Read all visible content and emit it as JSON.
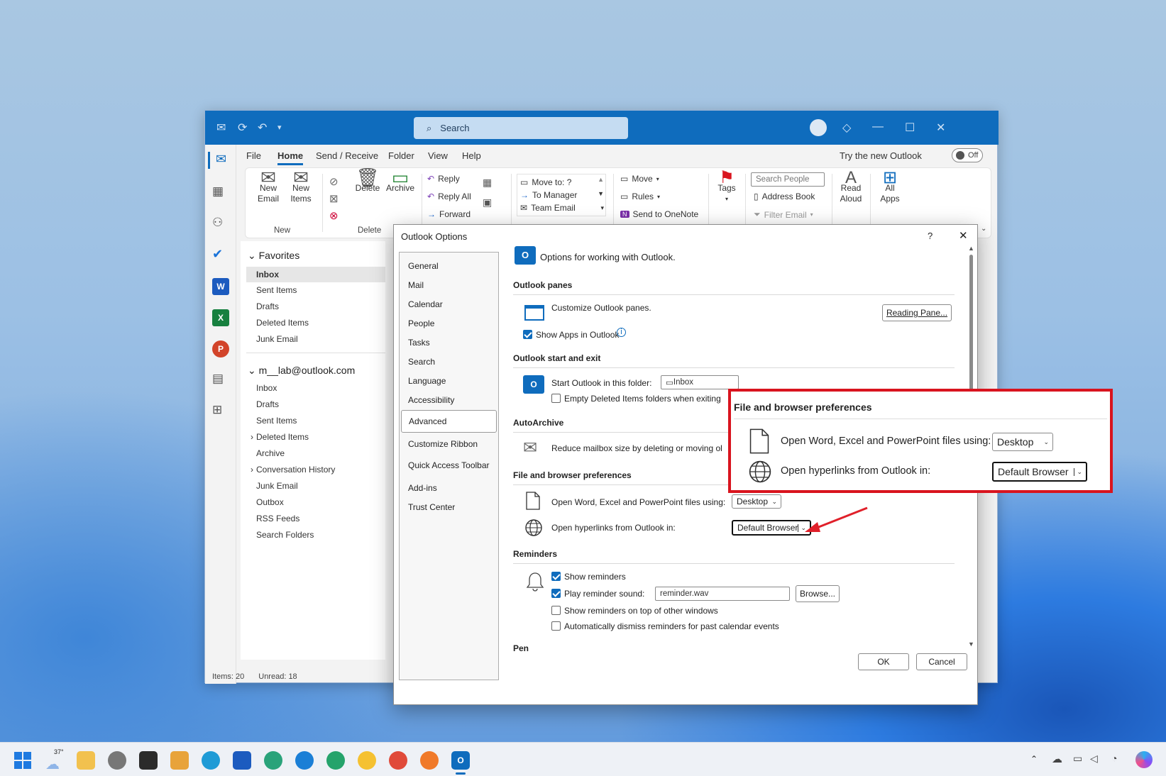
{
  "window": {
    "search_placeholder": "Search",
    "menu": [
      "File",
      "Home",
      "Send / Receive",
      "Folder",
      "View",
      "Help"
    ],
    "try_new": "Try the new Outlook",
    "toggle_label": "Off"
  },
  "ribbon": {
    "new_email": "New Email",
    "new_items": "New Items",
    "group_new": "New",
    "delete": "Delete",
    "archive": "Archive",
    "group_delete": "Delete",
    "reply": "Reply",
    "reply_all": "Reply All",
    "forward": "Forward",
    "quick_steps": [
      "Move to: ?",
      "To Manager",
      "Team Email"
    ],
    "move": "Move",
    "rules": "Rules",
    "send_onenote": "Send to OneNote",
    "tags": "Tags",
    "search_people": "Search People",
    "address_book": "Address Book",
    "filter_email": "Filter Email",
    "read_aloud": "Read Aloud",
    "all_apps": "All Apps"
  },
  "folders": {
    "favorites_header": "Favorites",
    "favorites": [
      "Inbox",
      "Sent Items",
      "Drafts",
      "Deleted Items",
      "Junk Email"
    ],
    "account_header": "m__lab@outlook.com",
    "account_items": [
      "Inbox",
      "Drafts",
      "Sent Items",
      "Deleted Items",
      "Archive",
      "Conversation History",
      "Junk Email",
      "Outbox",
      "RSS Feeds",
      "Search Folders"
    ]
  },
  "status": {
    "items": "Items: 20",
    "unread": "Unread: 18"
  },
  "dialog": {
    "title": "Outlook Options",
    "help": "?",
    "nav": [
      "General",
      "Mail",
      "Calendar",
      "People",
      "Tasks",
      "Search",
      "Language",
      "Accessibility",
      "Advanced",
      "Customize Ribbon",
      "Quick Access Toolbar",
      "Add-ins",
      "Trust Center"
    ],
    "intro": "Options for working with Outlook.",
    "sec_panes": "Outlook panes",
    "customize_panes": "Customize Outlook panes.",
    "reading_pane_btn": "Reading Pane...",
    "show_apps": "Show Apps in Outlook",
    "sec_start": "Outlook start and exit",
    "start_folder_label": "Start Outlook in this folder:",
    "start_folder_value": "Inbox",
    "empty_deleted": "Empty Deleted Items folders when exiting",
    "sec_autoarchive": "AutoArchive",
    "autoarchive_text": "Reduce mailbox size by deleting or moving ol",
    "sec_file": "File and browser preferences",
    "open_files_label": "Open Word, Excel and PowerPoint files using:",
    "open_files_value": "Desktop",
    "open_links_label": "Open hyperlinks from Outlook in:",
    "open_links_value": "Default Browser",
    "sec_reminders": "Reminders",
    "show_reminders": "Show reminders",
    "play_sound": "Play reminder sound:",
    "sound_file": "reminder.wav",
    "browse_btn": "Browse...",
    "on_top": "Show reminders on top of other windows",
    "auto_dismiss": "Automatically dismiss reminders for past calendar events",
    "sec_pen": "Pen",
    "ok": "OK",
    "cancel": "Cancel"
  },
  "callout": {
    "title": "File and browser preferences",
    "open_files_label": "Open Word, Excel and PowerPoint files using:",
    "open_files_value": "Desktop",
    "open_links_label": "Open hyperlinks from Outlook in:",
    "open_links_value": "Default Browser"
  },
  "taskbar": {
    "weather": "37°"
  },
  "colors": {
    "accent": "#0f6cbd",
    "callout_border": "#d9141e",
    "arrow": "#e0202a"
  }
}
